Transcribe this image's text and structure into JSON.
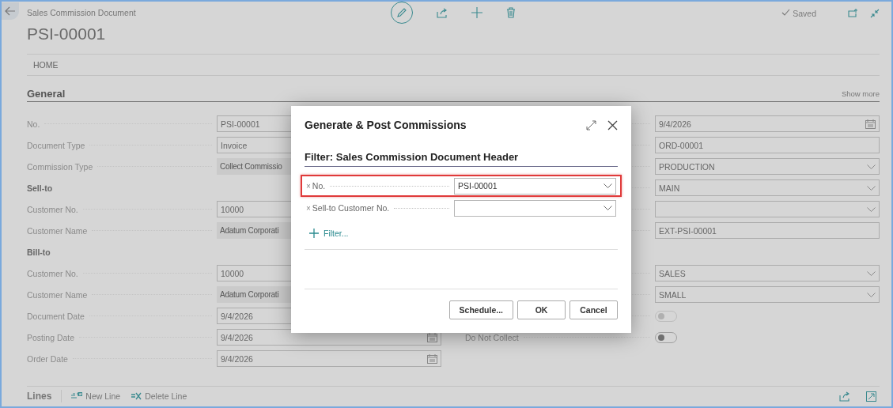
{
  "page": {
    "caption": "Sales Commission Document",
    "title": "PSI-00001",
    "status": "Saved"
  },
  "action_bar": {
    "label": "HOME"
  },
  "section": {
    "title": "General",
    "show_more": "Show more"
  },
  "left_fields": [
    {
      "kind": "text",
      "label": "No.",
      "value": "PSI-00001"
    },
    {
      "kind": "text",
      "label": "Document Type",
      "value": "Invoice"
    },
    {
      "kind": "readonly",
      "label": "Commission Type",
      "value": "Collect Commissio"
    },
    {
      "kind": "group",
      "label": "Sell-to"
    },
    {
      "kind": "text",
      "label": "Customer No.",
      "value": "10000"
    },
    {
      "kind": "readonly",
      "label": "Customer Name",
      "value": "Adatum Corporati"
    },
    {
      "kind": "group",
      "label": "Bill-to"
    },
    {
      "kind": "text",
      "label": "Customer No.",
      "value": "10000"
    },
    {
      "kind": "readonly",
      "label": "Customer Name",
      "value": "Adatum Corporati"
    },
    {
      "kind": "text",
      "label": "Document Date",
      "value": "9/4/2026"
    },
    {
      "kind": "date",
      "label": "Posting Date",
      "value": "9/4/2026"
    },
    {
      "kind": "date",
      "label": "Order Date",
      "value": "9/4/2026"
    }
  ],
  "right_groups": [
    {
      "fields": [
        {
          "kind": "date",
          "value": "9/4/2026"
        },
        {
          "kind": "text",
          "value": "ORD-00001"
        },
        {
          "kind": "dropdown",
          "value": "PRODUCTION"
        },
        {
          "kind": "dropdown",
          "value": "MAIN"
        },
        {
          "kind": "dropdown"
        },
        {
          "kind": "text",
          "value": "EXT-PSI-00001"
        }
      ]
    },
    {
      "fields": [
        {
          "kind": "dropdown",
          "value": "SALES"
        },
        {
          "kind": "dropdown",
          "value": "SMALL"
        },
        {
          "kind": "toggle",
          "on": false,
          "disabled": true
        },
        {
          "kind": "toggle",
          "label": "Do Not Collect",
          "on": false,
          "disabled": false
        }
      ]
    }
  ],
  "lines_part": {
    "title": "Lines",
    "actions": [
      {
        "kind": "new",
        "label": "New Line"
      },
      {
        "kind": "delete",
        "label": "Delete Line"
      }
    ]
  },
  "dialog": {
    "title": "Generate & Post Commissions",
    "filter_heading": "Filter: Sales Commission Document Header",
    "filters": [
      {
        "remove": "×",
        "label": "No.",
        "value": "PSI-00001",
        "highlighted": true
      },
      {
        "remove": "×",
        "label": "Sell-to Customer No.",
        "highlighted": false
      }
    ],
    "add_filter": "Filter...",
    "buttons": [
      "Schedule...",
      "OK",
      "Cancel"
    ]
  }
}
